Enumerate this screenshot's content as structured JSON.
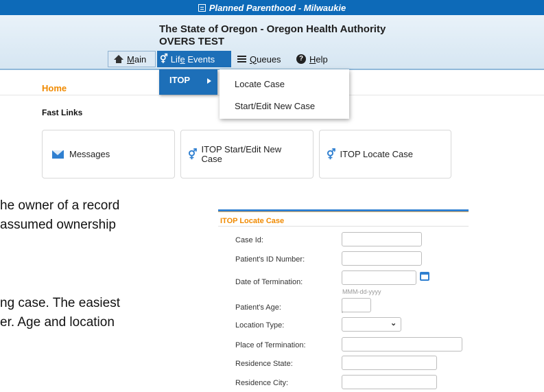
{
  "header": {
    "org_link": "Planned Parenthood - Milwaukie",
    "agency": "The State of Oregon - Oregon Health Authority",
    "environment": "OVERS TEST",
    "colors": {
      "brand_blue": "#0d6ab8",
      "active_menu": "#1d6fb8",
      "accent_orange": "#f08a00"
    }
  },
  "nav": {
    "main": {
      "pre": "",
      "ul": "M",
      "post": "ain"
    },
    "life_events": {
      "pre": "Lif",
      "ul": "e",
      "post": " Events"
    },
    "queues": {
      "pre": "",
      "ul": "Q",
      "post": "ueues"
    },
    "help": {
      "pre": "",
      "ul": "H",
      "post": "elp"
    }
  },
  "submenu": {
    "itop": "ITOP"
  },
  "flyout": {
    "items": [
      "Locate Case",
      "Start/Edit New Case"
    ]
  },
  "home": {
    "title": "Home",
    "fast_links_title": "Fast Links",
    "cards": [
      {
        "label": "Messages",
        "icon": "envelope-icon"
      },
      {
        "label_line1": "ITOP Start/Edit New",
        "label_line2": "Case",
        "icon": "gender-icon"
      },
      {
        "label": "ITOP Locate Case",
        "icon": "gender-icon"
      }
    ]
  },
  "background_text": [
    "he owner of a record",
    " assumed ownership",
    "ng case. The easiest",
    "er. Age and location"
  ],
  "locate_panel": {
    "title": "ITOP Locate Case",
    "fields": [
      "Case Id:",
      "Patient's ID Number:",
      "Date of Termination:",
      "Patient's Age:",
      "Location Type:",
      "Place of Termination:",
      "Residence State:",
      "Residence City:"
    ],
    "date_placeholder": "MMM-dd-yyyy"
  }
}
